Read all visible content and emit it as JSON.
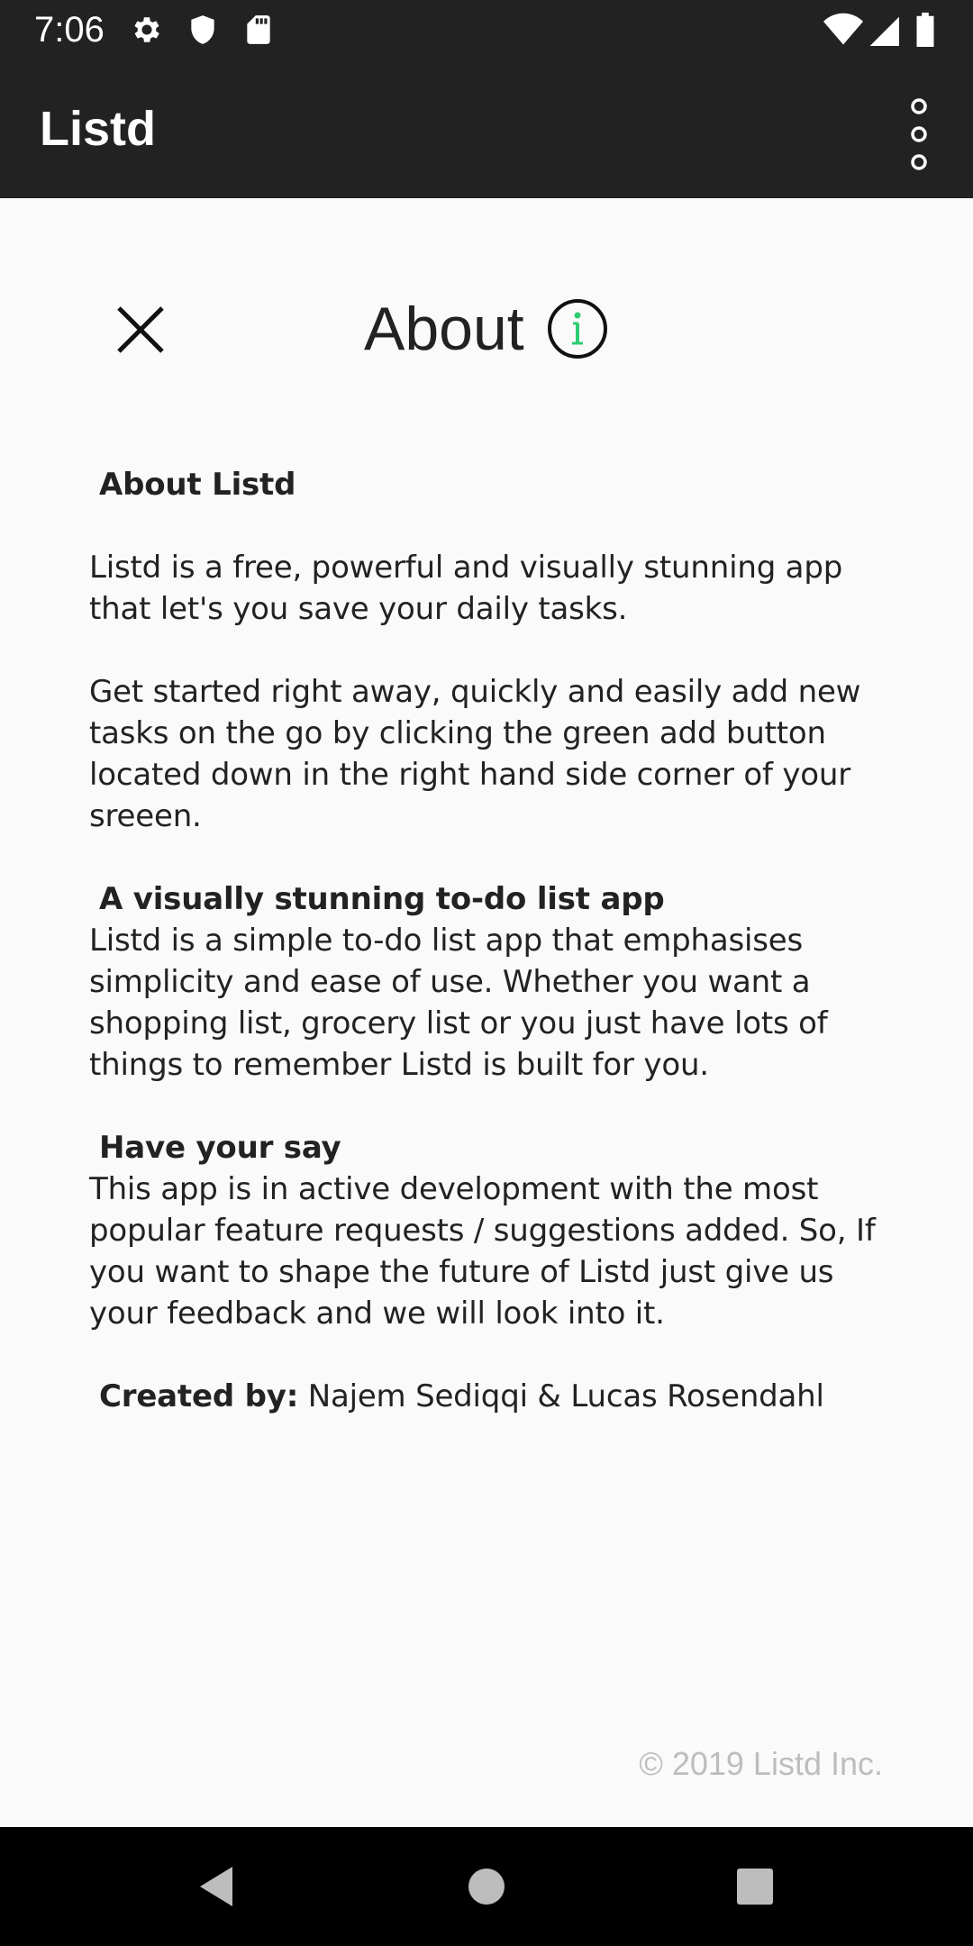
{
  "status_bar": {
    "time": "7:06",
    "icons": [
      "gear-icon",
      "shield-icon",
      "sd-card-icon",
      "wifi-icon",
      "signal-icon",
      "battery-icon"
    ]
  },
  "app_bar": {
    "title": "Listd",
    "menu_icon": "overflow-menu-icon"
  },
  "dialog": {
    "title": "About",
    "close_icon": "close-icon",
    "info_icon": "info-icon",
    "accent_color": "#2ecc71"
  },
  "content": {
    "section1_heading": "About Listd",
    "section1_text": " Listd is a free, powerful and visually stunning app that let's you save your daily tasks.",
    "section2_text": " Get started right away, quickly and easily add new tasks on the go by clicking the green add button located down in the right hand side corner of your sreeen.",
    "section3_heading": "A visually stunning to-do list app",
    "section3_text": " Listd is a simple to-do list app that emphasises simplicity and ease of use. Whether you want a shopping list, grocery list or you just have lots of things to remember Listd is built for you.",
    "section4_heading": "Have your say",
    "section4_text": " This app is in active development with the most popular feature requests / suggestions added. So, If you want to shape the future of Listd just give us your feedback and we will look into it.",
    "credits_label": "Created by:",
    "credits_names": " Najem Sediqqi & Lucas Rosendahl"
  },
  "footer": {
    "copyright": "© 2019 Listd Inc."
  },
  "nav_bar": {
    "buttons": [
      "back-icon",
      "home-icon",
      "recents-icon"
    ]
  }
}
